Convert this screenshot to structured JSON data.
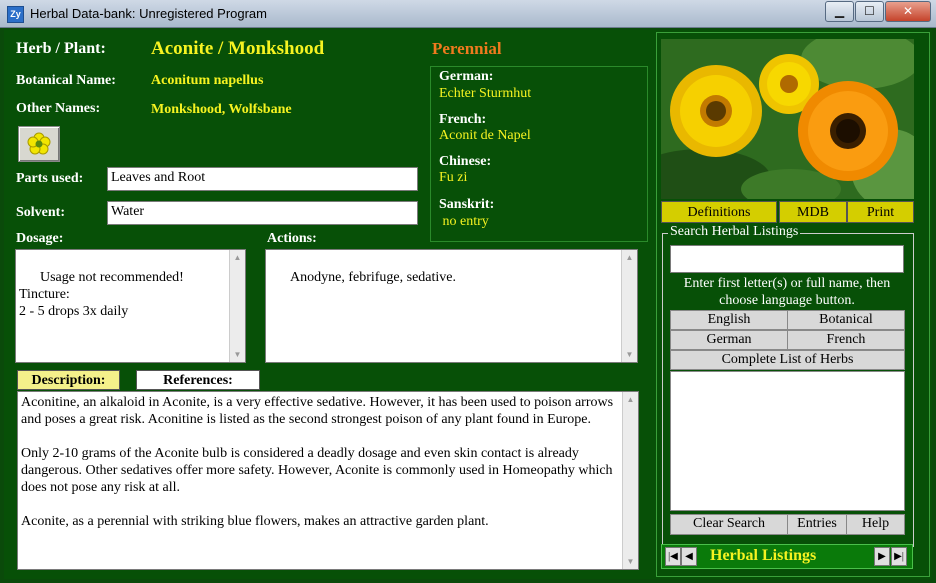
{
  "window": {
    "title": "Herbal Data-bank: Unregistered Program",
    "icon": "app-icon"
  },
  "herb": {
    "herb_label": "Herb / Plant:",
    "herb_name": "Aconite / Monkshood",
    "botanical_label": "Botanical Name:",
    "botanical_value": "Aconitum napellus",
    "other_label": "Other Names:",
    "other_value": "Monkshood, Wolfsbane",
    "parts_label": "Parts used:",
    "parts_value": "Leaves and Root",
    "solvent_label": "Solvent:",
    "solvent_value": "Water",
    "type": "Perennial"
  },
  "languages": [
    {
      "label": "German:",
      "value": "Echter Sturmhut"
    },
    {
      "label": "French:",
      "value": "Aconit de Napel"
    },
    {
      "label": "Chinese:",
      "value": "Fu zi"
    },
    {
      "label": "Sanskrit:",
      "value": " no entry"
    }
  ],
  "dosage": {
    "label": "Dosage:",
    "text": "Usage not recommended!\nTincture:\n2 - 5 drops 3x daily"
  },
  "actions": {
    "label": "Actions:",
    "text": "Anodyne, febrifuge, sedative."
  },
  "tabs": {
    "description": "Description:",
    "references": "References:"
  },
  "description": {
    "p1": "Aconitine, an alkaloid in Aconite, is a very effective sedative. However, it has been used to poison arrows and poses a great risk. Aconitine is listed as the second strongest poison of any plant found in Europe.",
    "p2": "Only 2-10 grams of the Aconite bulb is considered a deadly dosage and even skin contact is already dangerous. Other sedatives offer more safety. However, Aconite is commonly used in Homeopathy which does not pose any risk at all.",
    "p3": "Aconite, as a perennial with striking blue flowers, makes an attractive garden plant."
  },
  "right_buttons": {
    "definitions": "Definitions",
    "mdb": "MDB",
    "print": "Print"
  },
  "search": {
    "group_title": "Search Herbal Listings",
    "input_value": "",
    "hint": "Enter first letter(s) or full name, then choose language button.",
    "english": "English",
    "botanical": "Botanical",
    "german": "German",
    "french": "French",
    "complete": "Complete List of Herbs",
    "clear": "Clear Search",
    "entries": "Entries",
    "help": "Help"
  },
  "nav": {
    "label": "Herbal Listings"
  },
  "colors": {
    "panel_green": "#075007",
    "accent_yellow": "#f6f321",
    "perennial_orange": "#f07a1e",
    "button_yellow": "#d4ce00"
  }
}
